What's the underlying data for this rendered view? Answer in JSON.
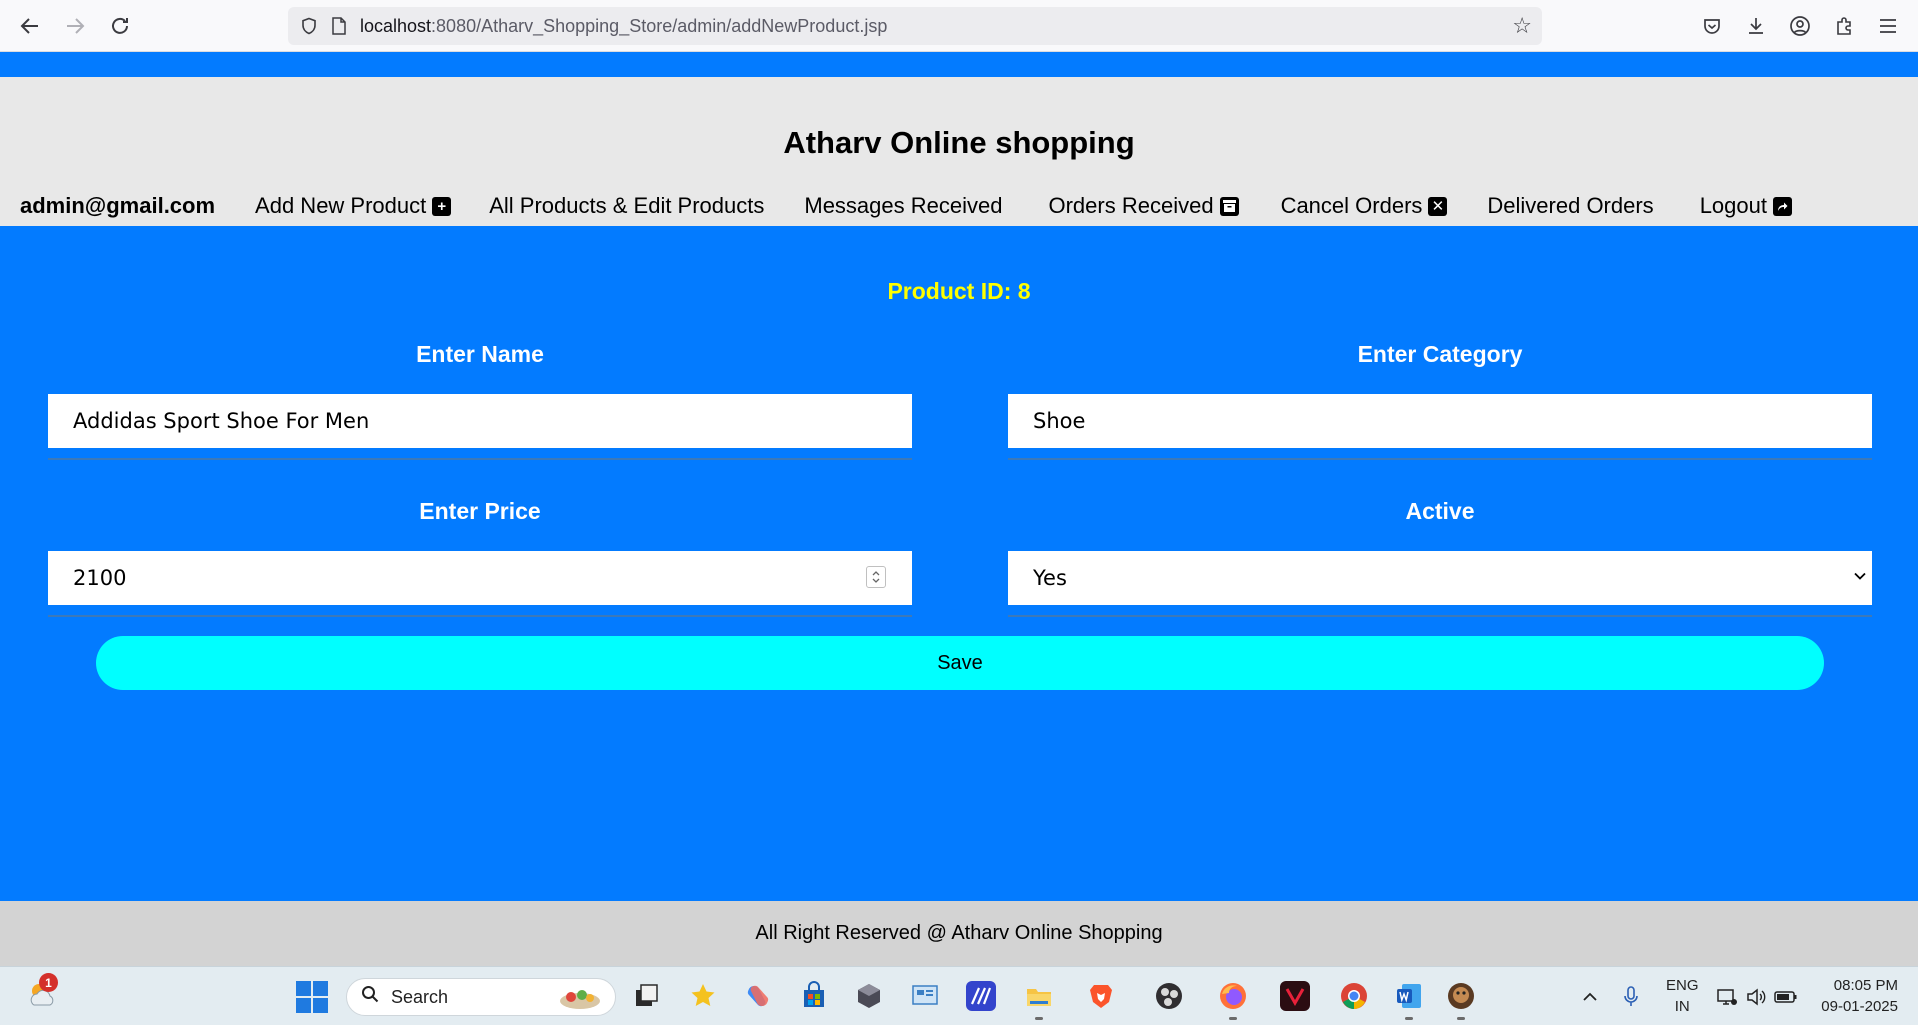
{
  "browser": {
    "url_host": "localhost",
    "url_rest": ":8080/Atharv_Shopping_Store/admin/addNewProduct.jsp"
  },
  "header": {
    "site_title": "Atharv Online shopping",
    "nav": {
      "email": "admin@gmail.com",
      "add_new_product": "Add New Product",
      "all_products": "All Products & Edit Products",
      "messages": "Messages Received",
      "orders_received": "Orders Received",
      "cancel_orders": "Cancel Orders",
      "delivered_orders": "Delivered Orders",
      "logout": "Logout"
    }
  },
  "form": {
    "product_id": "Product ID: 8",
    "name_label": "Enter Name",
    "name_value": "Addidas Sport Shoe For Men",
    "category_label": "Enter Category",
    "category_value": "Shoe",
    "price_label": "Enter Price",
    "price_value": "2100",
    "active_label": "Active",
    "active_value": "Yes",
    "save_label": "Save"
  },
  "footer": {
    "text": "All Right Reserved @ Atharv Online Shopping"
  },
  "taskbar": {
    "notification_count": "1",
    "search_label": "Search",
    "lang_line1": "ENG",
    "lang_line2": "IN",
    "time": "08:05 PM",
    "date": "09-01-2025"
  },
  "colors": {
    "page_background": "#037bff",
    "header_background": "#e8e8e8",
    "product_id_color": "#ffff00",
    "save_button": "#00ffff",
    "footer_background": "#d3d3d3"
  }
}
